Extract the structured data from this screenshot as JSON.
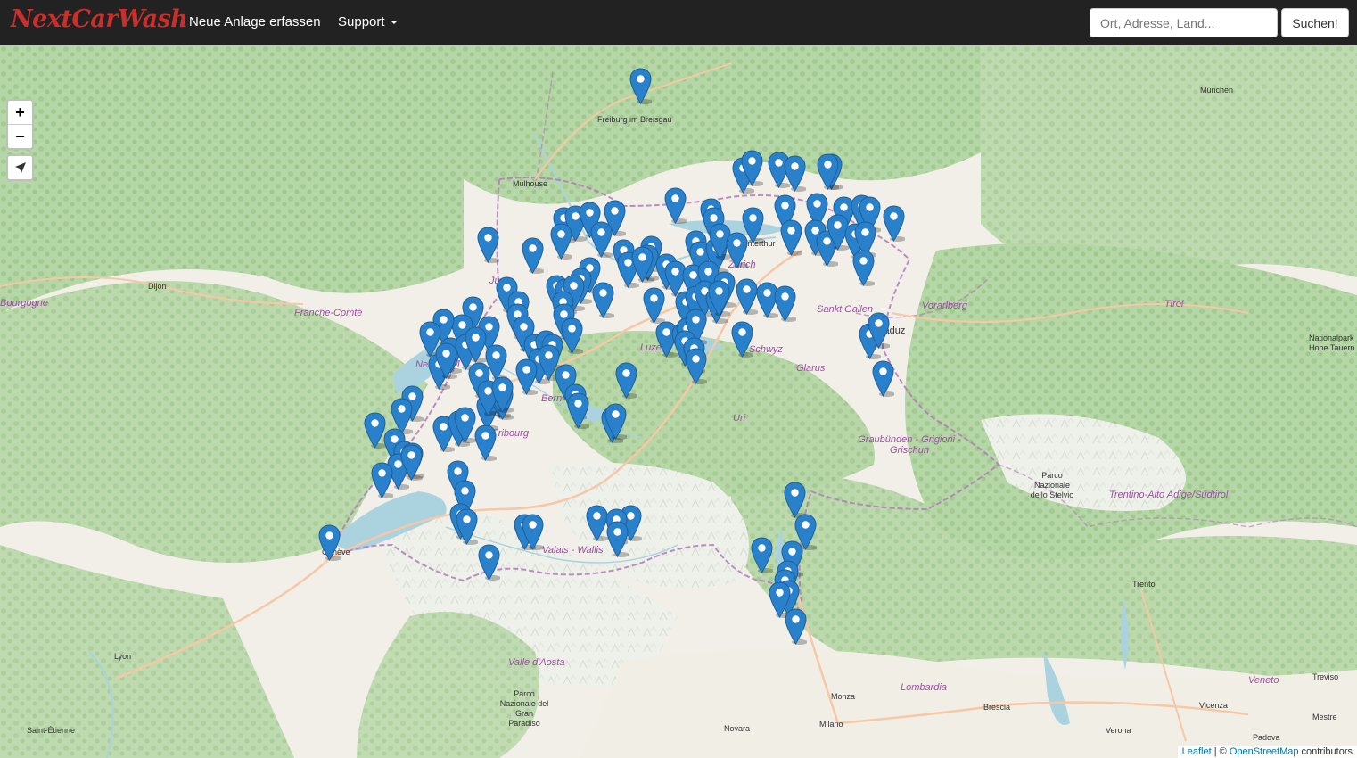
{
  "brand": "NextCarWash",
  "nav": {
    "new_facility": "Neue Anlage erfassen",
    "support": "Support"
  },
  "search": {
    "placeholder": "Ort, Adresse, Land...",
    "button": "Suchen!"
  },
  "map_controls": {
    "zoom_in": "+",
    "zoom_out": "−",
    "locate_icon": "location-arrow-icon"
  },
  "attribution": {
    "leaflet": "Leaflet",
    "separator": " | © ",
    "osm": "OpenStreetMap",
    "suffix": " contributors"
  },
  "colors": {
    "navbar": "#222222",
    "brand": "#c9302c",
    "marker": "#2a81cb",
    "map_green": "#add19e",
    "map_base": "#f2efe9",
    "water": "#aad3df",
    "border": "#b07ab8"
  },
  "places": [
    "Freiburg im Breisgau",
    "München",
    "Mulhouse",
    "Dijon",
    "Franche-Comté",
    "Bourgogne",
    "Vorarlberg",
    "Tirol",
    "Sankt Gallen",
    "Vaduz",
    "Nationalpark Hohe Tauern",
    "Glarus",
    "Uri",
    "Luzern",
    "Schwyz",
    "Zürich",
    "Winterthur",
    "Bern",
    "Fribourg",
    "Genève",
    "Valais - Wallis",
    "Graubünden - Grigioni - Grischun",
    "Parco Nazionale dello Stelvio",
    "Trentino-Alto Adige/Südtirol",
    "Trento",
    "Lyon",
    "Saint-Étienne",
    "Valle d'Aosta",
    "Parco Nazionale del Gran Paradiso",
    "Lombardia",
    "Brescia",
    "Monza",
    "Milano",
    "Novara",
    "Veneto",
    "Treviso",
    "Vicenza",
    "Verona",
    "Padova",
    "Mestre",
    "Jura",
    "Neuchâtel"
  ]
}
